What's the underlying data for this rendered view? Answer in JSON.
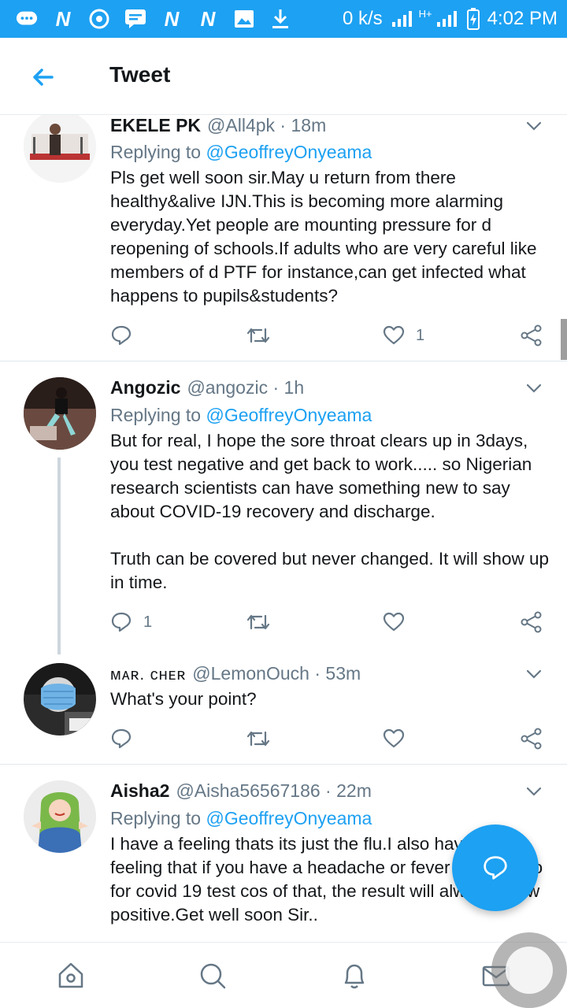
{
  "status_bar": {
    "data_speed": "0 k/s",
    "network": "H+",
    "time": "4:02 PM"
  },
  "header": {
    "title": "Tweet"
  },
  "tweets": [
    {
      "name": "EKELE PK",
      "handle": "@All4pk",
      "sep": "·",
      "time": "18m",
      "replying_prefix": "Replying to ",
      "replying_to": "@GeoffreyOnyeama",
      "text": "Pls get well soon sir.May u return from there healthy&alive IJN.This is becoming more alarming everyday.Yet people are mounting pressure for d reopening of schools.If adults who are very careful like members of d PTF for instance,can get infected what happens to pupils&students?",
      "reply_count": "",
      "retweet_count": "",
      "like_count": "1"
    },
    {
      "name": "Angozic",
      "handle": "@angozic",
      "sep": "·",
      "time": "1h",
      "replying_prefix": "Replying to ",
      "replying_to": "@GeoffreyOnyeama",
      "text": "But for real, I hope the sore throat clears up in 3days, you test negative and get back to work..... so Nigerian research scientists can have something new to say about COVID-19 recovery and discharge.\n\nTruth can be covered but never changed. It will show up in time.",
      "reply_count": "1",
      "retweet_count": "",
      "like_count": ""
    },
    {
      "name": "ᴍᴀʀ. ᴄʜᴇʀ",
      "handle": "@LemonOuch",
      "sep": "·",
      "time": "53m",
      "text": "What's your point?",
      "reply_count": "",
      "retweet_count": "",
      "like_count": ""
    },
    {
      "name": "Aisha2",
      "handle": "@Aisha56567186",
      "sep": "·",
      "time": "22m",
      "replying_prefix": "Replying to ",
      "replying_to": "@GeoffreyOnyeama",
      "text": "I have a feeling thats its just the flu.I also have the feeling that if you have a headache or fever and you go for covid 19 test cos of that, the result will always show positive.Get well soon Sir..",
      "reply_count": "",
      "retweet_count": "",
      "like_count": ""
    }
  ],
  "colors": {
    "brand": "#1da1f2",
    "secondary_text": "#657786",
    "primary_text": "#14171a"
  },
  "icons": {
    "back": "arrow-left-icon",
    "reply": "reply-icon",
    "retweet": "retweet-icon",
    "like": "heart-icon",
    "share": "share-icon",
    "compose": "compose-reply-icon",
    "nav": [
      "home-icon",
      "search-icon",
      "notifications-icon",
      "messages-icon"
    ]
  }
}
